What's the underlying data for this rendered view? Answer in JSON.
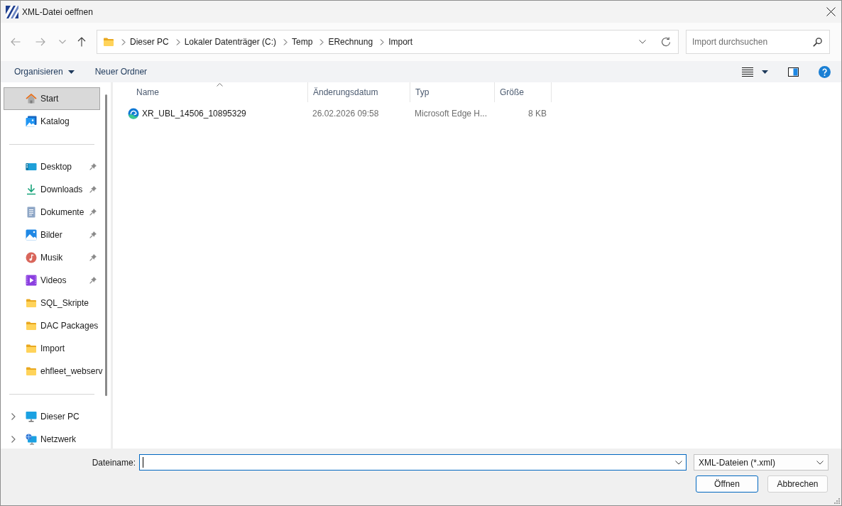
{
  "window": {
    "title": "XML-Datei oeffnen"
  },
  "navigation": [
    {
      "kind": "back",
      "disabled": true
    },
    {
      "kind": "forward",
      "disabled": true
    },
    {
      "kind": "recent",
      "disabled": true
    },
    {
      "kind": "up",
      "disabled": false
    }
  ],
  "address_bar": {
    "breadcrumbs": [
      "Dieser PC",
      "Lokaler Datenträger (C:)",
      "Temp",
      "ERechnung",
      "Import"
    ]
  },
  "search": {
    "placeholder": "Import durchsuchen"
  },
  "toolbar": {
    "commands": [
      {
        "label": "Organisieren",
        "kind": "menu"
      },
      {
        "label": "Neuer Ordner",
        "kind": "button"
      }
    ]
  },
  "sidebar": {
    "groups": [
      {
        "items": [
          {
            "label": "Start",
            "kind": "home",
            "selected": true,
            "pinned": false
          },
          {
            "label": "Katalog",
            "kind": "gallery",
            "selected": false,
            "pinned": false
          }
        ]
      },
      {
        "items": [
          {
            "label": "Desktop",
            "kind": "desktop",
            "selected": false,
            "pinned": true
          },
          {
            "label": "Downloads",
            "kind": "downloads",
            "selected": false,
            "pinned": true
          },
          {
            "label": "Dokumente",
            "kind": "documents",
            "selected": false,
            "pinned": true
          },
          {
            "label": "Bilder",
            "kind": "pictures",
            "selected": false,
            "pinned": true
          },
          {
            "label": "Musik",
            "kind": "music",
            "selected": false,
            "pinned": true
          },
          {
            "label": "Videos",
            "kind": "videos",
            "selected": false,
            "pinned": true
          },
          {
            "label": "SQL_Skripte",
            "kind": "folder",
            "selected": false,
            "pinned": false
          },
          {
            "label": "DAC Packages",
            "kind": "folder",
            "selected": false,
            "pinned": false
          },
          {
            "label": "Import",
            "kind": "folder",
            "selected": false,
            "pinned": false
          },
          {
            "label": "ehfleet_webserv",
            "kind": "folder",
            "selected": false,
            "pinned": false
          }
        ]
      },
      {
        "items": [
          {
            "label": "Dieser PC",
            "kind": "pc",
            "selected": false,
            "pinned": false,
            "expanded": false
          },
          {
            "label": "Netzwerk",
            "kind": "network",
            "selected": false,
            "pinned": false,
            "expanded": false
          }
        ]
      }
    ]
  },
  "file_list": {
    "columns": [
      {
        "label": "Name",
        "sorted": true
      },
      {
        "label": "Änderungsdatum",
        "sorted": false
      },
      {
        "label": "Typ",
        "sorted": false
      },
      {
        "label": "Größe",
        "sorted": false
      }
    ],
    "rows": [
      {
        "name": "XR_UBL_14506_10895329",
        "modified": "26.02.2026 09:58",
        "type": "Microsoft Edge H...",
        "size": "8 KB",
        "selected": false
      }
    ]
  },
  "file_name": {
    "label": "Dateiname:",
    "focused": true
  },
  "file_type": {
    "value": "XML-Dateien (*.xml)"
  },
  "buttons": [
    {
      "label": "Öffnen",
      "default": true
    },
    {
      "label": "Abbrechen",
      "default": false
    }
  ]
}
